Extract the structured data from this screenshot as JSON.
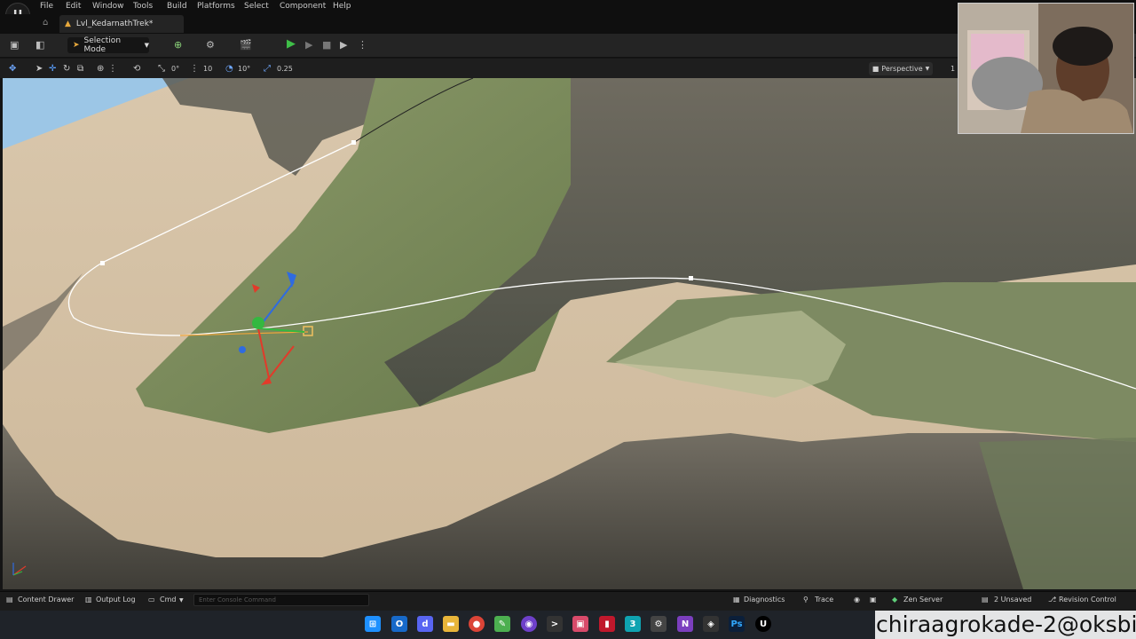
{
  "menu": {
    "items": [
      "File",
      "Edit",
      "Window",
      "Tools",
      "Build",
      "Platforms",
      "Select",
      "Component",
      "Help"
    ]
  },
  "tab": {
    "level_name": "Lvl_KedarnathTrek*"
  },
  "toolbar": {
    "selection_mode": "Selection Mode"
  },
  "viewport_toolbar": {
    "translate_snap": "0°",
    "grid_snap": "10",
    "rotation_snap": "10°",
    "scale_snap": "0.25",
    "view_mode": "Perspective",
    "extra": "1"
  },
  "statusbar": {
    "content_drawer": "Content Drawer",
    "output_log": "Output Log",
    "cmd": "Cmd",
    "console_placeholder": "Enter Console Command",
    "diagnostics": "Diagnostics",
    "trace": "Trace",
    "zen_server": "Zen Server",
    "unsaved": "2 Unsaved",
    "revision_control": "Revision Control"
  },
  "taskbar": {
    "watermark": "chiraagrokade-2@oksbi",
    "icons": [
      "windows-start",
      "outlook",
      "discord",
      "file-explorer",
      "chrome",
      "notepad",
      "github",
      "terminal",
      "photos",
      "app-red",
      "app-teal",
      "network",
      "visual-studio",
      "davinci",
      "photoshop",
      "unreal-engine"
    ]
  },
  "colors": {
    "axis_x": "#e23a2a",
    "axis_y": "#34b840",
    "axis_z": "#2f6be0",
    "spline": "#ffffff",
    "accent": "#e8a93c"
  }
}
